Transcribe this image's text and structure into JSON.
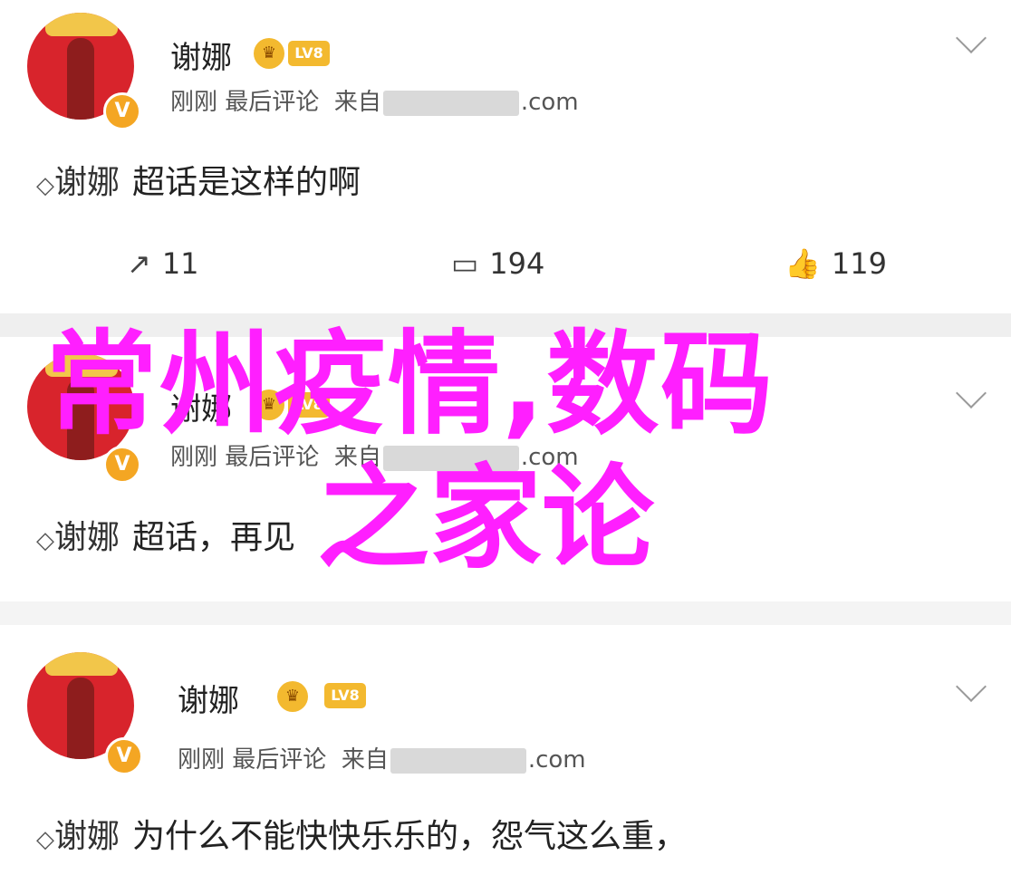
{
  "posts": [
    {
      "username": "谢娜",
      "badge_icon": "crown-icon",
      "level_badge": "LV8",
      "time": "刚刚",
      "meta_action": "最后评论",
      "source_prefix": "来自",
      "source_suffix": ".com",
      "reply_to": "谢娜",
      "comment": "超话是这样的啊",
      "shares": "11",
      "comments": "194",
      "likes": "119"
    },
    {
      "username": "谢娜",
      "badge_icon": "crown-icon",
      "level_badge": "LV8",
      "time": "刚刚",
      "meta_action": "最后评论",
      "source_prefix": "来自",
      "source_suffix": ".com",
      "reply_to": "谢娜",
      "comment": "超话，再见"
    },
    {
      "username": "谢娜",
      "badge_icon": "crown-icon",
      "level_badge": "LV8",
      "time": "刚刚",
      "meta_action": "最后评论",
      "source_prefix": "来自",
      "source_suffix": ".com",
      "reply_to": "谢娜",
      "comment": "为什么不能快快乐乐的，怨气这么重，"
    }
  ],
  "overlay": {
    "line1": "常州疫情,数码",
    "line2": "之家论"
  },
  "colors": {
    "overlay": "#ff1fff",
    "avatar": "#d8242c",
    "badge": "#f3b92f",
    "separator": "#efefef"
  }
}
